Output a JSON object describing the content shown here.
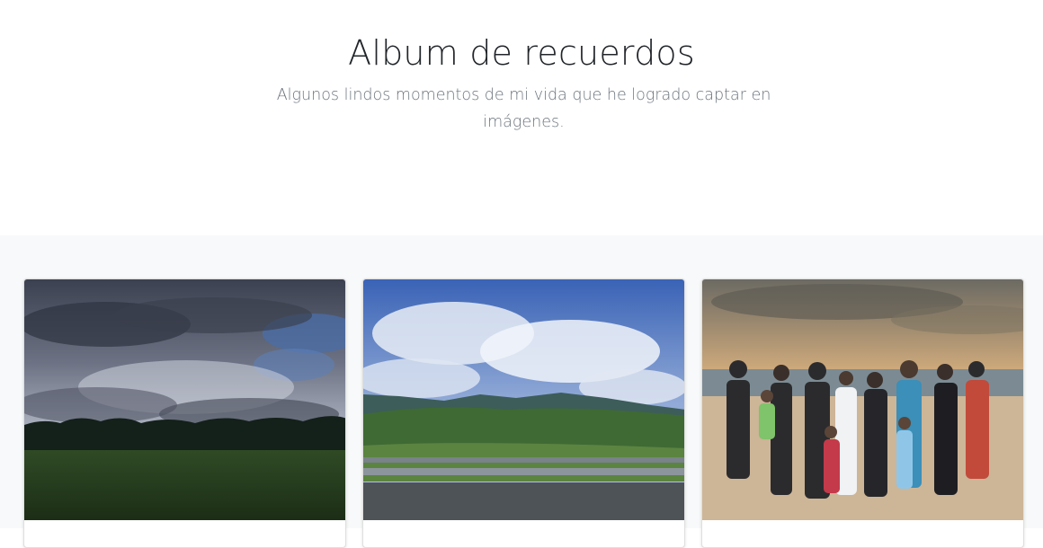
{
  "header": {
    "title": "Album de recuerdos",
    "lead": "Algunos lindos momentos de mi vida que he logrado captar en imágenes."
  },
  "album": {
    "background": "#f8f9fa",
    "cards": [
      {
        "image": "photo-stormy-clouds-over-field"
      },
      {
        "image": "photo-mountains-from-highway"
      },
      {
        "image": "photo-family-group-on-beach-at-sunset"
      }
    ]
  }
}
